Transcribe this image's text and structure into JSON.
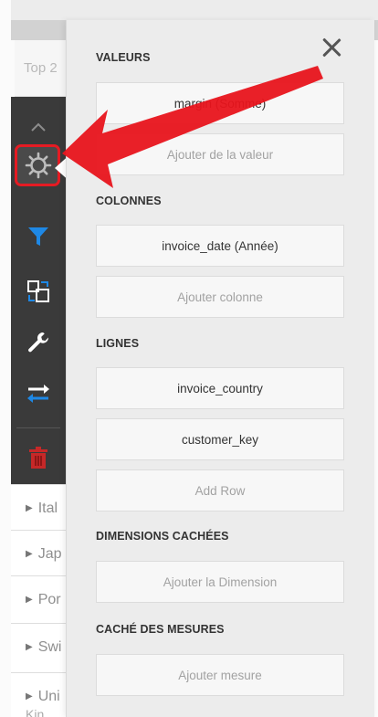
{
  "background": {
    "title_fragment": "Top 2"
  },
  "toolbar": {
    "icons": [
      "collapse-up-icon",
      "gear-icon",
      "filter-icon",
      "layout-icon",
      "wrench-icon",
      "swap-icon",
      "trash-icon"
    ],
    "highlight_color": "#e51b23",
    "filter_color": "#1e88e5",
    "delete_color": "#c62828"
  },
  "rows": [
    {
      "label": "Ital"
    },
    {
      "label": "Jap"
    },
    {
      "label": "Por"
    },
    {
      "label": "Swi"
    },
    {
      "label": "Uni"
    }
  ],
  "rows_extra": "Kin",
  "panel": {
    "close_icon": "close-icon",
    "sections": {
      "values": {
        "title": "VALEURS",
        "items": [
          "margin (Somme)"
        ],
        "add_label": "Ajouter de la valeur"
      },
      "columns": {
        "title": "COLONNES",
        "items": [
          "invoice_date (Année)"
        ],
        "add_label": "Ajouter colonne"
      },
      "rows": {
        "title": "LIGNES",
        "items": [
          "invoice_country",
          "customer_key"
        ],
        "add_label": "Add Row"
      },
      "hidden_dimensions": {
        "title": "DIMENSIONS CACHÉES",
        "add_label": "Ajouter la Dimension"
      },
      "hidden_measures": {
        "title": "CACHÉ DES MESURES",
        "add_label": "Ajouter mesure"
      }
    }
  },
  "annotation": {
    "arrow_color": "#e8141c",
    "target": "gear-icon"
  }
}
